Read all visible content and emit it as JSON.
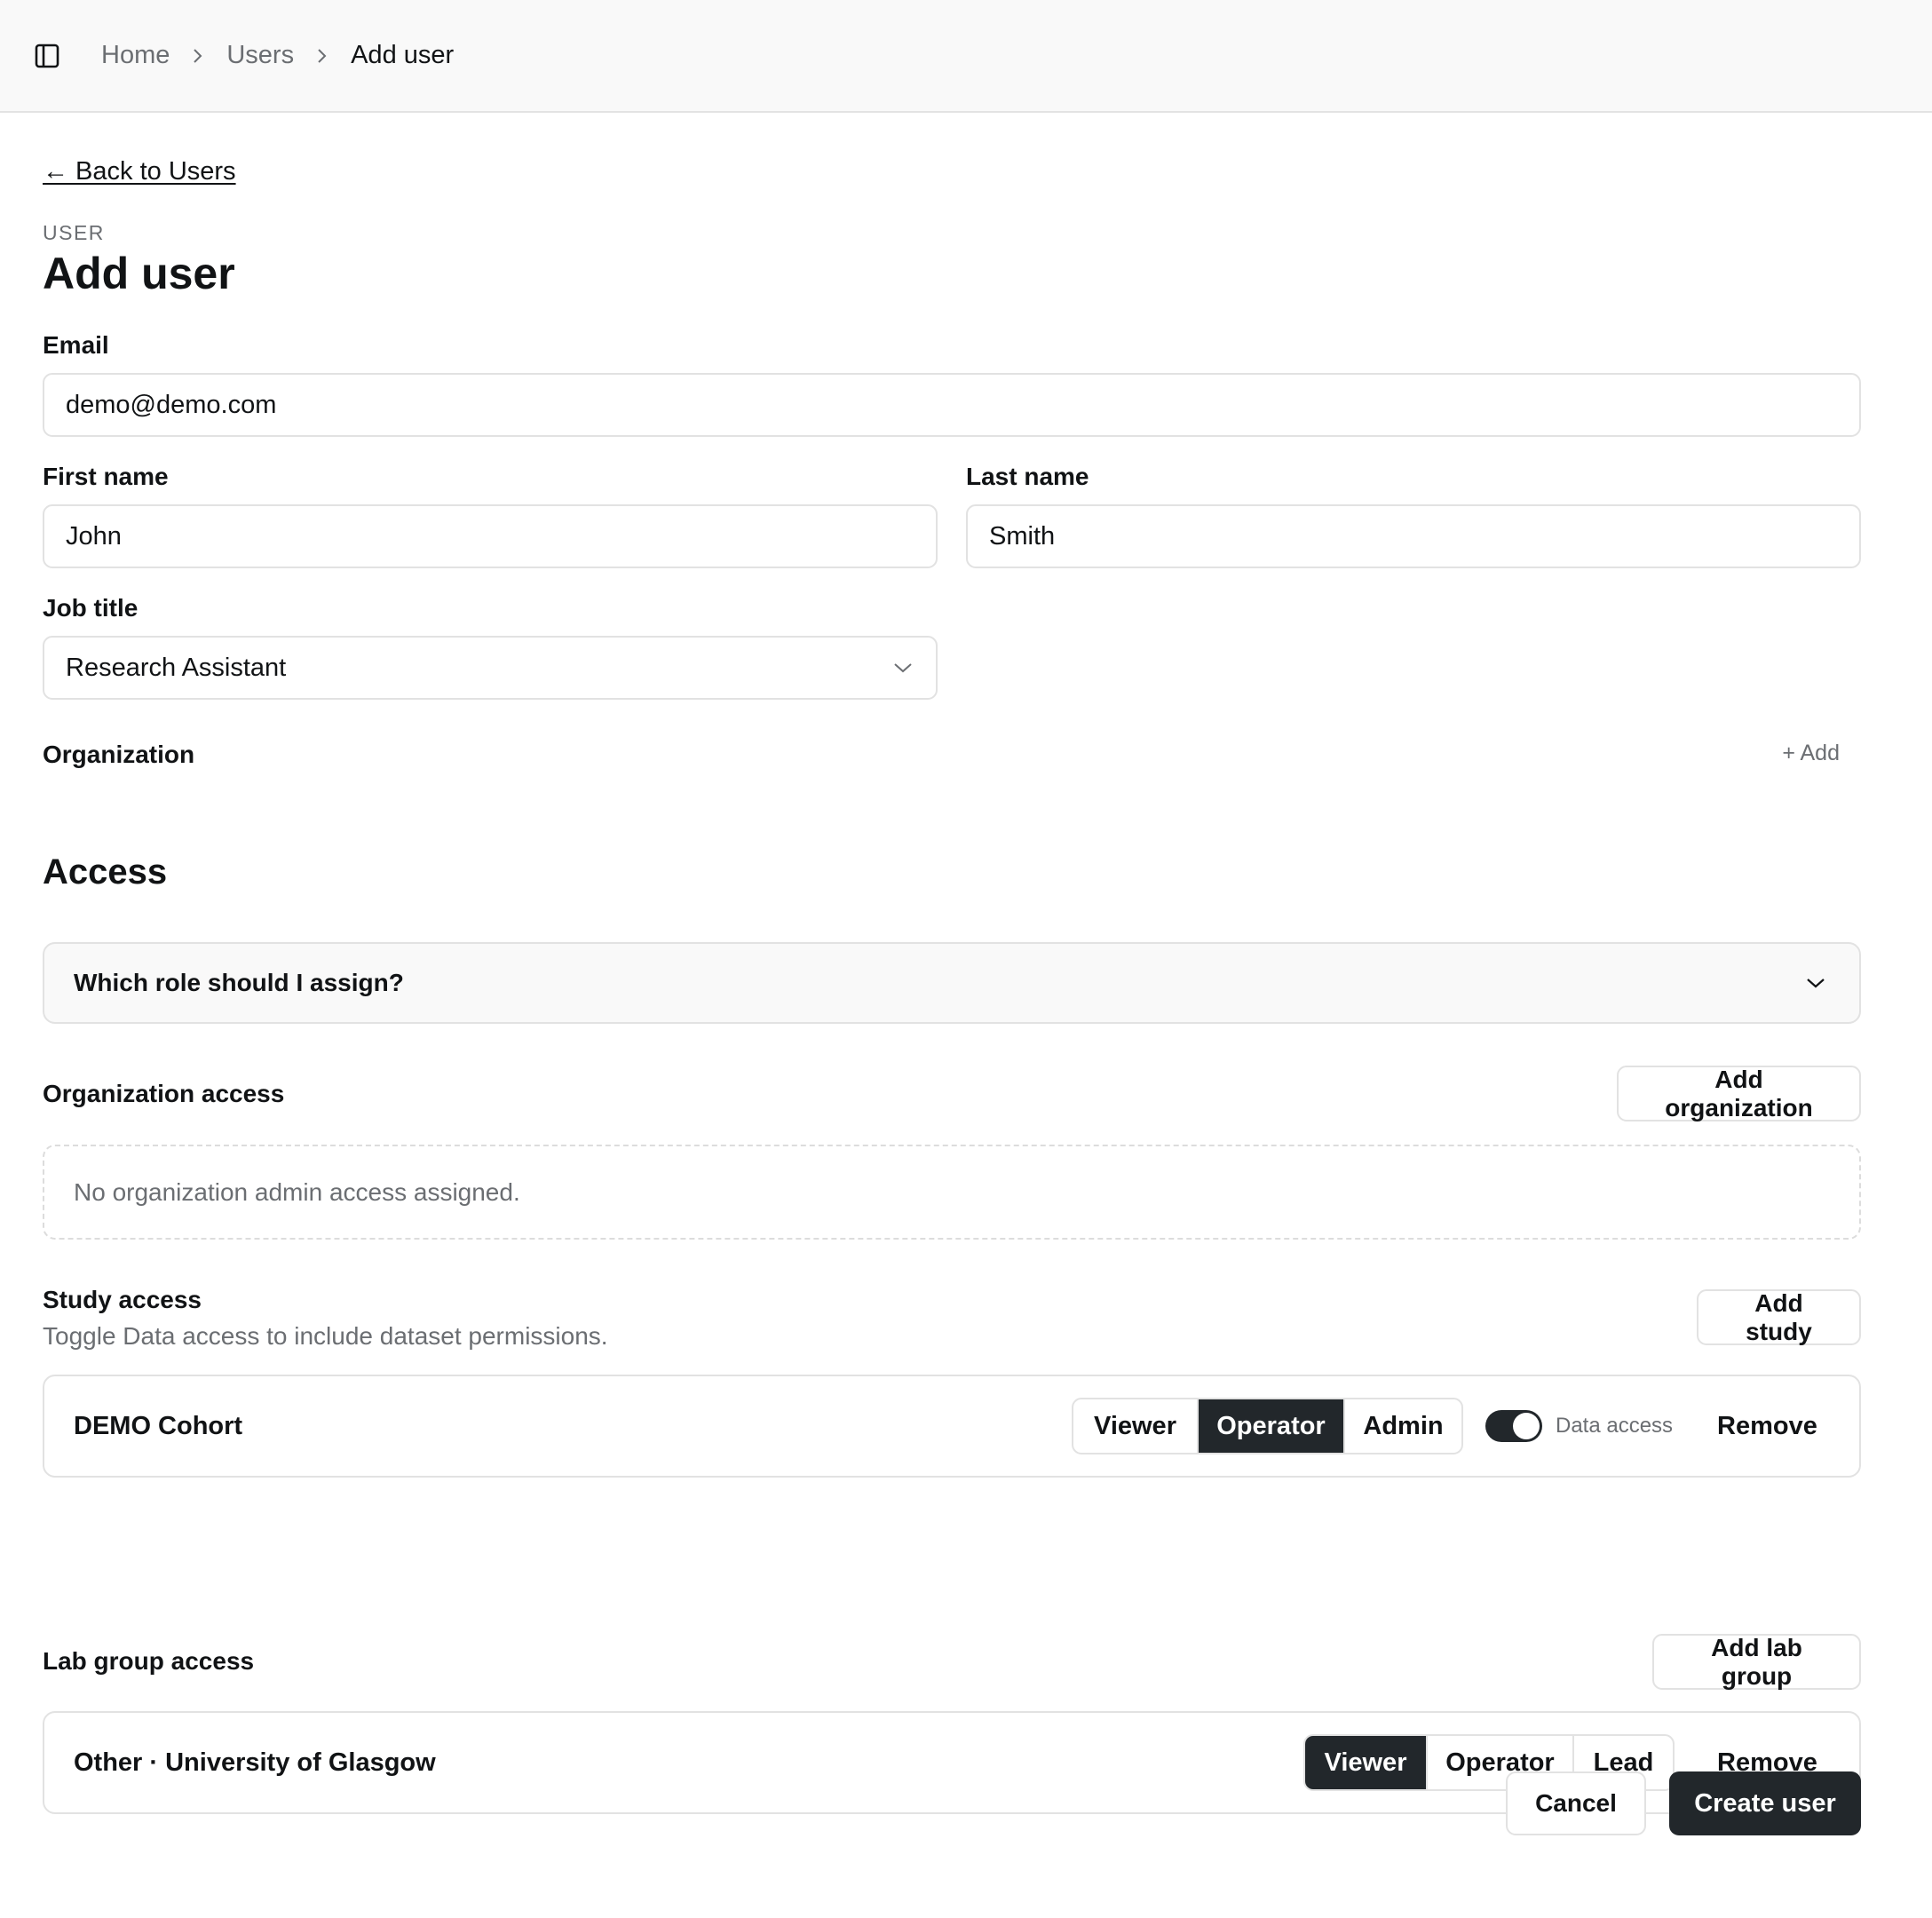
{
  "breadcrumb": {
    "items": [
      "Home",
      "Users",
      "Add user"
    ]
  },
  "back_link": "← Back to Users",
  "header": {
    "eyebrow": "USER",
    "title": "Add user"
  },
  "form": {
    "email": {
      "label": "Email",
      "value": "demo@demo.com"
    },
    "first_name": {
      "label": "First name",
      "value": "John"
    },
    "last_name": {
      "label": "Last name",
      "value": "Smith"
    },
    "job_title": {
      "label": "Job title",
      "value": "Research Assistant"
    },
    "organization": {
      "label": "Organization",
      "add_label": "+ Add"
    }
  },
  "access": {
    "title": "Access",
    "help_accordion": "Which role should I assign?",
    "organization_access": {
      "label": "Organization access",
      "add_button": "Add organization",
      "empty_text": "No organization admin access assigned."
    },
    "study_access": {
      "label": "Study access",
      "hint": "Toggle Data access to include dataset permissions.",
      "add_button": "Add study",
      "rows": [
        {
          "name": "DEMO Cohort",
          "roles": [
            "Viewer",
            "Operator",
            "Admin"
          ],
          "selected_role": "Operator",
          "data_access_label": "Data access",
          "data_access_on": true,
          "remove_label": "Remove"
        }
      ]
    },
    "lab_group_access": {
      "label": "Lab group access",
      "add_button": "Add lab group",
      "rows": [
        {
          "name": "Other · University of Glasgow",
          "roles": [
            "Viewer",
            "Operator",
            "Lead"
          ],
          "selected_role": "Viewer",
          "remove_label": "Remove"
        }
      ]
    }
  },
  "footer": {
    "cancel_label": "Cancel",
    "submit_label": "Create user"
  },
  "icons": {
    "sidebar_toggle": "sidebar-panel-icon",
    "breadcrumb_separator": "chevron-right-icon",
    "select_arrow": "chevron-down-icon",
    "accordion_arrow": "chevron-down-icon"
  },
  "colors": {
    "primary": "#22272b",
    "muted_text": "#6b6e72",
    "border": "#e2e2e2",
    "topbar_bg": "#f9f9f9"
  }
}
